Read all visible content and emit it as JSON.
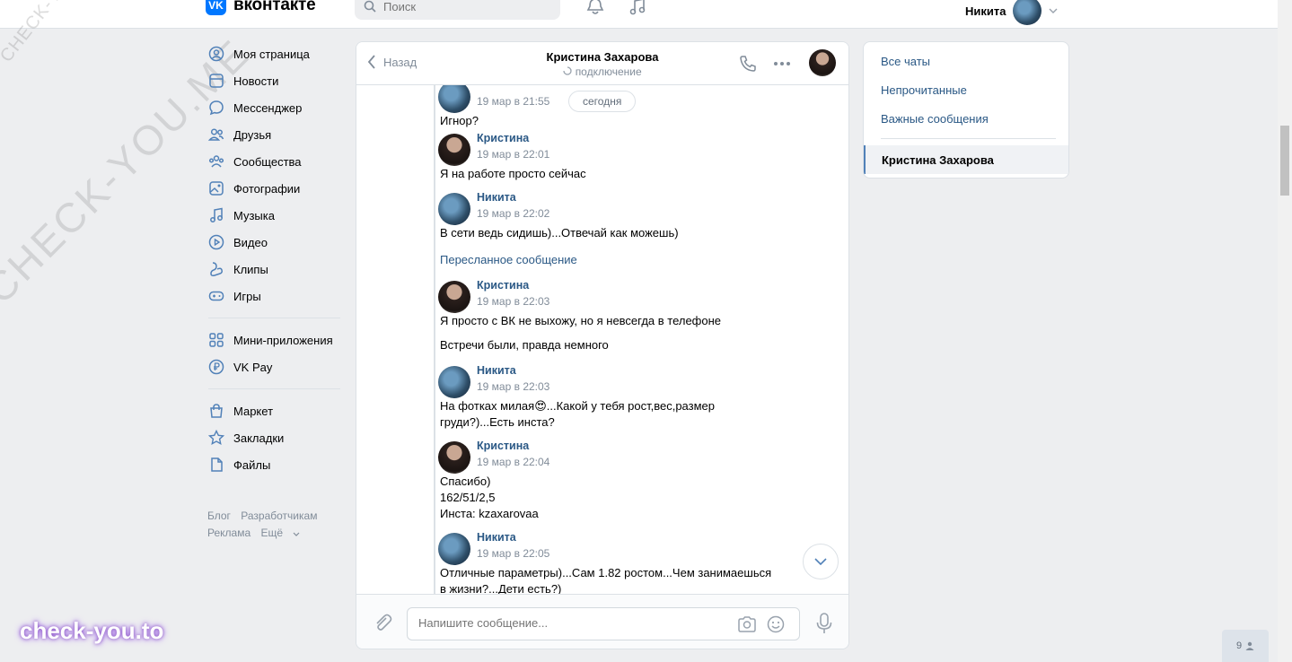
{
  "header": {
    "logo_badge": "VK",
    "logo_text": "вконтакте",
    "search_placeholder": "Поиск",
    "user_name": "Никита"
  },
  "sidebar": {
    "items": [
      {
        "label": "Моя страница",
        "icon": "user-icon"
      },
      {
        "label": "Новости",
        "icon": "news-icon"
      },
      {
        "label": "Мессенджер",
        "icon": "message-icon"
      },
      {
        "label": "Друзья",
        "icon": "friends-icon"
      },
      {
        "label": "Сообщества",
        "icon": "communities-icon"
      },
      {
        "label": "Фотографии",
        "icon": "photo-icon"
      },
      {
        "label": "Музыка",
        "icon": "music-icon"
      },
      {
        "label": "Видео",
        "icon": "video-icon"
      },
      {
        "label": "Клипы",
        "icon": "clips-icon"
      },
      {
        "label": "Игры",
        "icon": "games-icon"
      },
      {
        "label": "Мини-приложения",
        "icon": "apps-icon"
      },
      {
        "label": "VK Pay",
        "icon": "vkpay-icon"
      },
      {
        "label": "Маркет",
        "icon": "market-icon"
      },
      {
        "label": "Закладки",
        "icon": "bookmark-icon"
      },
      {
        "label": "Файлы",
        "icon": "files-icon"
      }
    ],
    "footer": [
      "Блог",
      "Разработчикам",
      "Реклама",
      "Ещё"
    ]
  },
  "chat": {
    "back_label": "Назад",
    "title": "Кристина Захарова",
    "status": "подключение",
    "date_pill": "сегодня",
    "messages": [
      {
        "time": "19 мар в 21:55",
        "text": "Игнор?"
      },
      {
        "author": "Кристина",
        "time": "19 мар в 22:01",
        "text": "Я на работе просто сейчас"
      },
      {
        "author": "Никита",
        "time": "19 мар в 22:02",
        "text": "В сети ведь сидишь)...Отвечай как можешь)"
      },
      {
        "forwarded_label": "Пересланное сообщение"
      },
      {
        "author": "Кристина",
        "time": "19 мар в 22:03",
        "text": "Я просто с ВК не выхожу, но я невсегда в телефоне",
        "extra": "Встречи были, правда немного"
      },
      {
        "author": "Никита",
        "time": "19 мар в 22:03",
        "text": "На фотках милая😍...Какой у тебя рост,вес,размер\nгруди?)...Есть инста?"
      },
      {
        "author": "Кристина",
        "time": "19 мар в 22:04",
        "text": "Спасибо)\n162/51/2,5\nИнста: kzaxarovaa"
      },
      {
        "author": "Никита",
        "time": "19 мар в 22:05",
        "text": "Отличные параметры)...Сам 1.82 ростом...Чем занимаешься\nв жизни?...Дети есть?)"
      }
    ],
    "composer_placeholder": "Напишите сообщение..."
  },
  "right_panel": {
    "filters": [
      "Все чаты",
      "Непрочитанные",
      "Важные сообщения"
    ],
    "active_chat": "Кристина Захарова"
  },
  "watermarks": {
    "small": "CHECK-YOU.ME",
    "big": "CHECK-YOU.ME",
    "brand": "check-you.to"
  },
  "online_count": "9",
  "colors": {
    "accent": "#0077ff",
    "link": "#2a5885",
    "background": "#edeef0"
  }
}
